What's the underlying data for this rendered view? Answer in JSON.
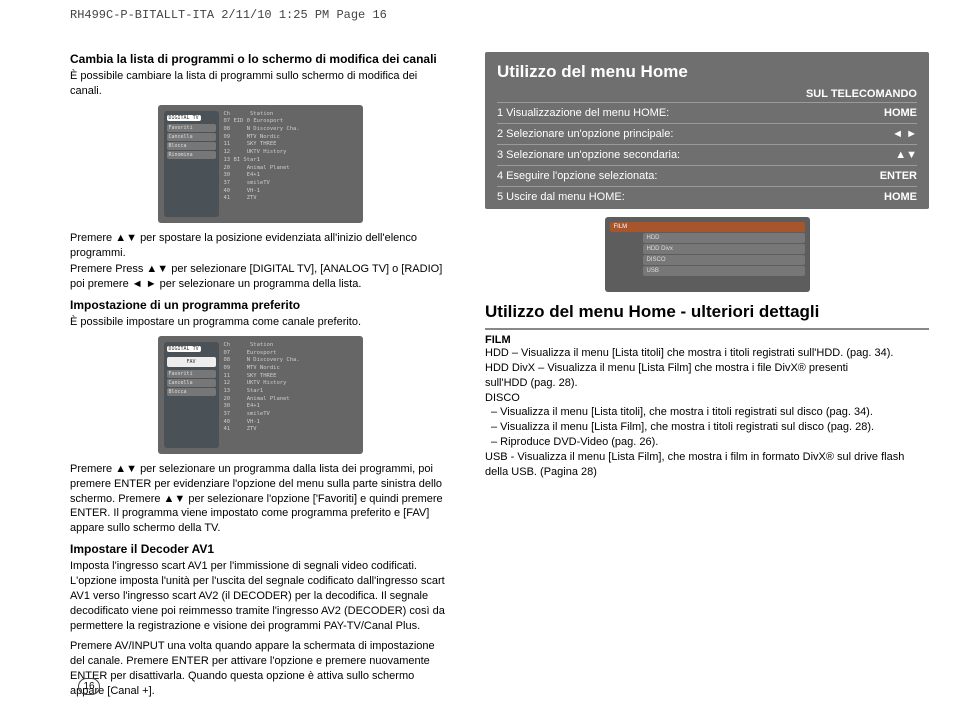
{
  "header": "RH499C-P-BITALLT-ITA  2/11/10  1:25 PM  Page 16",
  "left": {
    "title1": "Cambia la lista di programmi o lo schermo di modifica dei canali",
    "intro1": "È possibile cambiare la lista di programmi sullo schermo di modifica dei canali.",
    "scr1_left": {
      "digital": "DIGITAL TV",
      "btns": [
        "Favoriti",
        "Cancella",
        "Blocca",
        "Rinomina"
      ]
    },
    "scr1_cols": {
      "h1": "Ch",
      "h2": "Station"
    },
    "scr1_rows": [
      [
        "07",
        "EID 0",
        "Eurosport"
      ],
      [
        "08",
        "",
        "N Discovery Cha."
      ],
      [
        "09",
        "",
        "MTV Nordic"
      ],
      [
        "11",
        "",
        "SKY THREE"
      ],
      [
        "12",
        "",
        "UKTV History"
      ],
      [
        "13",
        "BI",
        "Star1"
      ],
      [
        "20",
        "",
        "Animal Planet"
      ],
      [
        "30",
        "",
        "E4+1"
      ],
      [
        "37",
        "",
        "smileTV"
      ],
      [
        "40",
        "",
        "VH-1"
      ],
      [
        "41",
        "",
        "ZTV"
      ]
    ],
    "para2a": "Premere ▲▼ per spostare la posizione evidenziata all'inizio dell'elenco programmi.",
    "para2b": "Premere Press ▲▼ per selezionare [DIGITAL TV], [ANALOG TV] o [RADIO] poi premere ◄ ► per selezionare un programma della lista.",
    "title2": "Impostazione di un programma preferito",
    "intro2": "È possibile impostare un programma come canale preferito.",
    "scr2_left": {
      "digital": "DIGITAL TV",
      "fav": "FAV"
    },
    "para3": "Premere ▲▼ per selezionare un programma dalla lista dei programmi, poi premere ENTER per evidenziare l'opzione del menu sulla parte sinistra dello schermo. Premere ▲▼  per selezionare l'opzione ['Favoriti] e quindi premere ENTER. Il programma viene impostato come programma preferito e [FAV] appare sullo schermo della TV.",
    "title3": "Impostare il Decoder AV1",
    "para4": "Imposta l'ingresso scart AV1 per l'immissione di segnali video codificati. L'opzione imposta l'unità per l'uscita del segnale codificato dall'ingresso scart AV1 verso l'ingresso scart AV2 (il DECODER) per la decodifica. Il segnale decodificato viene poi reimmesso tramite l'ingresso AV2 (DECODER) così da permettere la registrazione e visione dei programmi PAY-TV/Canal Plus.",
    "para5": "Premere AV/INPUT una volta quando appare la schermata di impostazione del canale. Premere ENTER per attivare l'opzione e premere nuovamente ENTER per disattivarla. Quando questa opzione è attiva sullo schermo appare [Canal +]."
  },
  "home": {
    "title": "Utilizzo del menu Home",
    "sub": "SUL TELECOMANDO",
    "rows": [
      {
        "l": "1 Visualizzazione del menu HOME:",
        "r": "HOME"
      },
      {
        "l": "2 Selezionare un'opzione principale:",
        "r": "◄ ►"
      },
      {
        "l": "3 Selezionare un'opzione secondaria:",
        "r": "▲▼"
      },
      {
        "l": "4 Eseguire l'opzione selezionata:",
        "r": "ENTER"
      },
      {
        "l": "5 Uscire dal menu HOME:",
        "r": "HOME"
      }
    ]
  },
  "menu_items": [
    "FILM",
    "HDD",
    "HDD Divx",
    "DISCO",
    "USB"
  ],
  "details": {
    "title": "Utilizzo del menu Home - ulteriori dettagli",
    "film": "FILM",
    "l1": "HDD – Visualizza il menu [Lista titoli] che mostra i titoli registrati sull'HDD. (pag. 34).",
    "l2a": "HDD DivX – Visualizza il menu [Lista Film] che mostra i file DivX® presenti",
    "l2b": "sull'HDD (pag. 28).",
    "l3": "DISCO",
    "l4": "–  Visualizza il menu [Lista titoli], che mostra i titoli registrati sul disco (pag. 34).",
    "l5": "–  Visualizza il menu [Lista Film], che mostra i titoli registrati sul disco (pag. 28).",
    "l6": "–  Riproduce DVD-Video (pag. 26).",
    "l7": "USB - Visualizza il menu [Lista Film], che mostra i film in formato DivX® sul drive flash della USB. (Pagina 28)"
  },
  "page_number": "16"
}
